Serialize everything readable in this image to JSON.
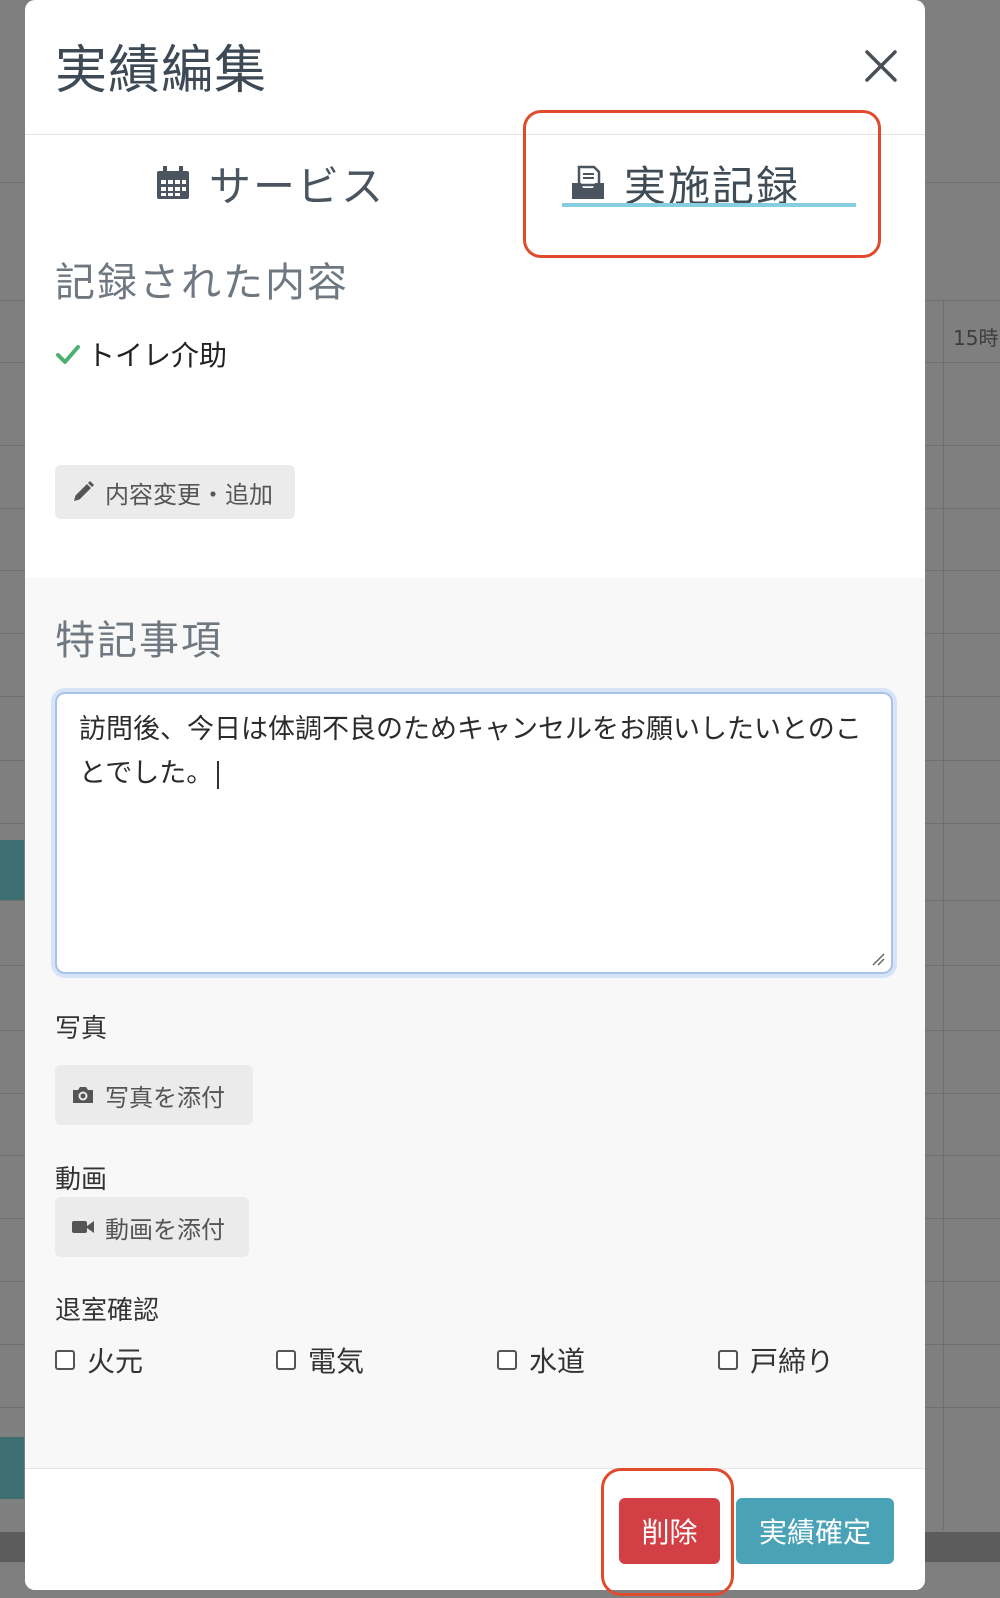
{
  "background": {
    "hour_label": "15時"
  },
  "modal": {
    "title": "実績編集",
    "tabs": [
      {
        "label": "サービス",
        "icon": "calendar-icon"
      },
      {
        "label": "実施記録",
        "icon": "inbox-document-icon",
        "active": true
      }
    ],
    "recorded": {
      "title": "記録された内容",
      "items": [
        {
          "label": "トイレ介助",
          "icon": "check-icon"
        }
      ],
      "edit_button_label": "内容変更・追加"
    },
    "notes": {
      "title": "特記事項",
      "text": "訪問後、今日は体調不良のためキャンセルをお願いしたいとのことでした。"
    },
    "photo": {
      "label": "写真",
      "button_label": "写真を添付"
    },
    "video": {
      "label": "動画",
      "button_label": "動画を添付"
    },
    "exit_check": {
      "label": "退室確認",
      "options": [
        {
          "label": "火元",
          "checked": false
        },
        {
          "label": "電気",
          "checked": false
        },
        {
          "label": "水道",
          "checked": false
        },
        {
          "label": "戸締り",
          "checked": false
        }
      ]
    },
    "footer": {
      "delete_label": "削除",
      "confirm_label": "実績確定"
    }
  },
  "colors": {
    "accent_underline": "#86cde0",
    "delete": "#d23f45",
    "confirm": "#4aa2b7",
    "annotation": "#e04b2e",
    "check": "#4cb16f"
  }
}
